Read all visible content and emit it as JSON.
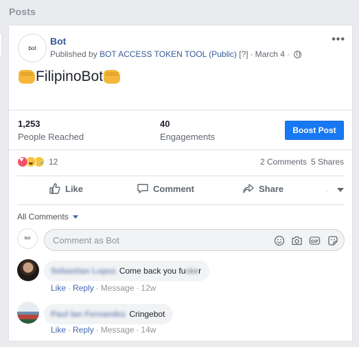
{
  "section": {
    "title": "Posts"
  },
  "post": {
    "avatar_text": "bot",
    "author": "Bot",
    "published_prefix": "Published by",
    "publisher": "BOT ACCESS TOKEN TOOL (Public)",
    "help": "[?]",
    "date": "March 4",
    "text": "FilipinoBot",
    "more": "•••"
  },
  "stats": {
    "reached": {
      "value": "1,253",
      "label": "People Reached"
    },
    "engagements": {
      "value": "40",
      "label": "Engagements"
    },
    "boost_label": "Boost Post"
  },
  "reactions": {
    "count": "12",
    "types": [
      "love",
      "haha",
      "sad"
    ],
    "comments": "2 Comments",
    "shares": "5 Shares"
  },
  "actions": {
    "like": "Like",
    "comment": "Comment",
    "share": "Share",
    "audience_dash": "-"
  },
  "comments_section": {
    "filter_label": "All Comments",
    "avatar_text": "bot",
    "placeholder": "Comment as Bot"
  },
  "comments": [
    {
      "name": "Sebastian Lopez",
      "text_prefix": "Come back you fu",
      "text_blur": "cke",
      "text_suffix": "r",
      "like": "Like",
      "reply": "Reply",
      "message": "Message",
      "time": "12w"
    },
    {
      "name": "Paul Ian Fernandez",
      "text_prefix": "Cringebot",
      "text_blur": "",
      "text_suffix": "",
      "like": "Like",
      "reply": "Reply",
      "message": "Message",
      "time": "14w"
    }
  ],
  "colors": {
    "link": "#365899",
    "boost": "#1877f2",
    "page_bg": "#e9ebee"
  }
}
